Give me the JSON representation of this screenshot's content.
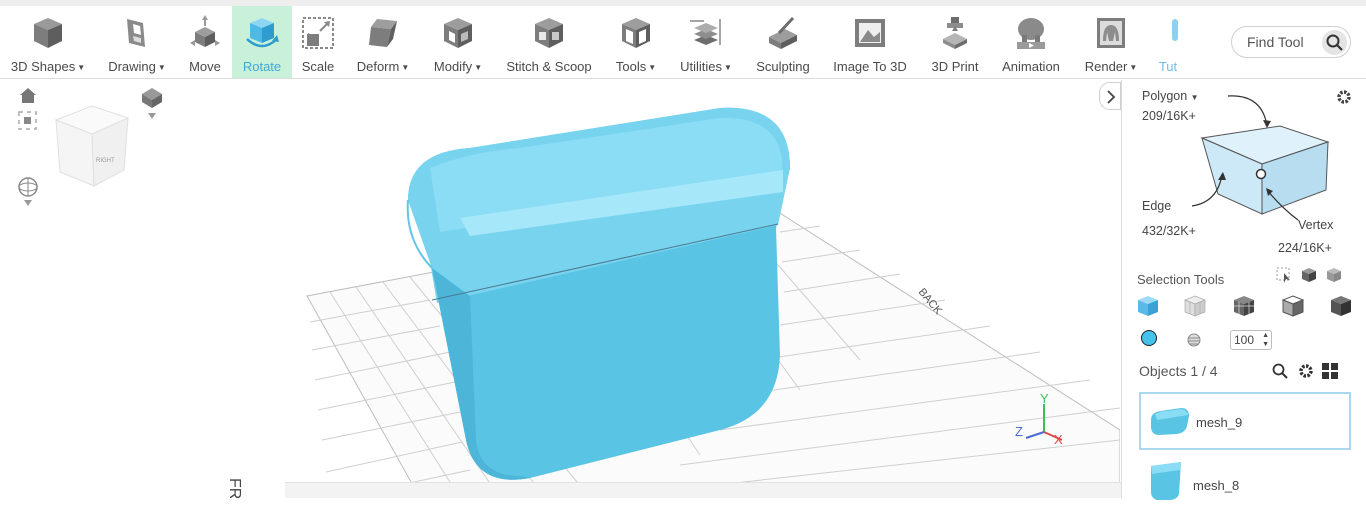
{
  "toolbar": {
    "tools": [
      {
        "label": "3D Shapes",
        "dropdown": true,
        "icon": "cube-icon"
      },
      {
        "label": "Drawing",
        "dropdown": true,
        "icon": "drawing-icon"
      },
      {
        "label": "Move",
        "dropdown": false,
        "icon": "move-icon"
      },
      {
        "label": "Rotate",
        "dropdown": false,
        "icon": "rotate-icon",
        "active": true
      },
      {
        "label": "Scale",
        "dropdown": false,
        "icon": "scale-icon"
      },
      {
        "label": "Deform",
        "dropdown": true,
        "icon": "deform-icon"
      },
      {
        "label": "Modify",
        "dropdown": true,
        "icon": "modify-icon"
      },
      {
        "label": "Stitch & Scoop",
        "dropdown": false,
        "icon": "stitch-scoop-icon"
      },
      {
        "label": "Tools",
        "dropdown": true,
        "icon": "tools-icon"
      },
      {
        "label": "Utilities",
        "dropdown": true,
        "icon": "utilities-icon"
      },
      {
        "label": "Sculpting",
        "dropdown": false,
        "icon": "sculpting-icon"
      },
      {
        "label": "Image To 3D",
        "dropdown": false,
        "icon": "image-to-3d-icon"
      },
      {
        "label": "3D Print",
        "dropdown": false,
        "icon": "printer-icon"
      },
      {
        "label": "Animation",
        "dropdown": false,
        "icon": "animation-icon"
      },
      {
        "label": "Render",
        "dropdown": true,
        "icon": "render-icon"
      },
      {
        "label": "Tut",
        "dropdown": false,
        "icon": "tutorial-icon"
      }
    ],
    "find_tool_placeholder": "Find Tool"
  },
  "viewport": {
    "view_cube_label": "RIGHT",
    "grid_back_label": "BACK",
    "grid_front_label": "FR",
    "axis_labels": {
      "x": "X",
      "y": "Y",
      "z": "Z"
    }
  },
  "right_panel": {
    "polygon_label": "Polygon",
    "polygon_count": "209/16K+",
    "edge_label": "Edge",
    "edge_count": "432/32K+",
    "vertex_label": "Vertex",
    "vertex_count": "224/16K+",
    "selection_tools_label": "Selection Tools",
    "opacity_value": "100",
    "objects_label": "Objects 1 / 4",
    "objects": [
      {
        "name": "mesh_9",
        "selected": true
      },
      {
        "name": "mesh_8",
        "selected": false
      }
    ]
  },
  "colors": {
    "accent": "#40a8d8",
    "active_tool_bg": "#c9f0d8",
    "mesh": "#5ac4e4",
    "object_color": "#45c2ea"
  }
}
